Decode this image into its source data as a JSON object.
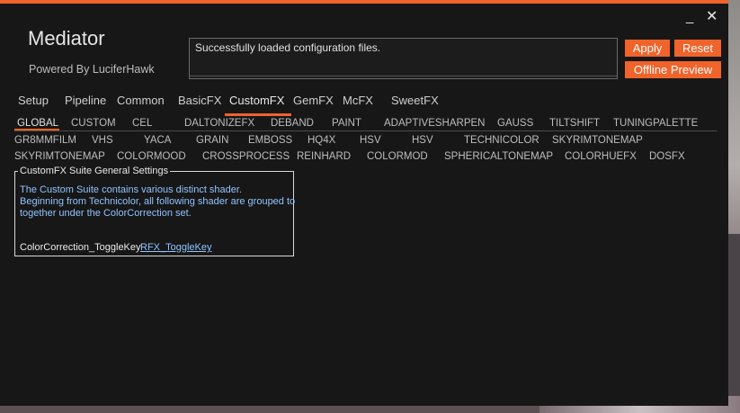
{
  "window": {
    "title": "Mediator",
    "subtitle": "Powered By LuciferHawk",
    "minimize_icon": "minimize-icon",
    "close_icon": "close-icon",
    "accent_color": "#f0632a"
  },
  "status": {
    "message": "Successfully loaded configuration files."
  },
  "buttons": {
    "apply": "Apply",
    "reset": "Reset",
    "offline_preview": "Offline Preview"
  },
  "tabs": [
    "Setup",
    "Pipeline",
    "Common",
    "BasicFX",
    "CustomFX",
    "GemFX",
    "McFX",
    "SweetFX"
  ],
  "active_tab": "CustomFX",
  "subtabs": {
    "row1": [
      "GLOBAL",
      "CUSTOM",
      "CEL",
      "DALTONIZEFX",
      "DEBAND",
      "PAINT",
      "ADAPTIVESHARPEN",
      "GAUSS",
      "TILTSHIFT",
      "TUNINGPALETTE"
    ],
    "row2": [
      "GR8MMFILM",
      "VHS",
      "YACA",
      "GRAIN",
      "EMBOSS",
      "HQ4X",
      "HSV",
      "HSV",
      "TECHNICOLOR",
      "SKYRIMTONEMAP"
    ],
    "row3": [
      "SKYRIMTONEMAP",
      "COLORMOOD",
      "CROSSPROCESS",
      "REINHARD",
      "COLORMOD",
      "SPHERICALTONEMAP",
      "COLORHUEFX",
      "DOSFX"
    ]
  },
  "active_subtab": "GLOBAL",
  "settings": {
    "group_title": "CustomFX Suite General Settings",
    "description": [
      "The Custom Suite contains various distinct shader.",
      "Beginning from Technicolor, all following shader are grouped to",
      "together under the ColorCorrection set."
    ],
    "toggle_key_label": "ColorCorrection_ToggleKey",
    "toggle_key_value": "RFX_ToggleKey"
  }
}
